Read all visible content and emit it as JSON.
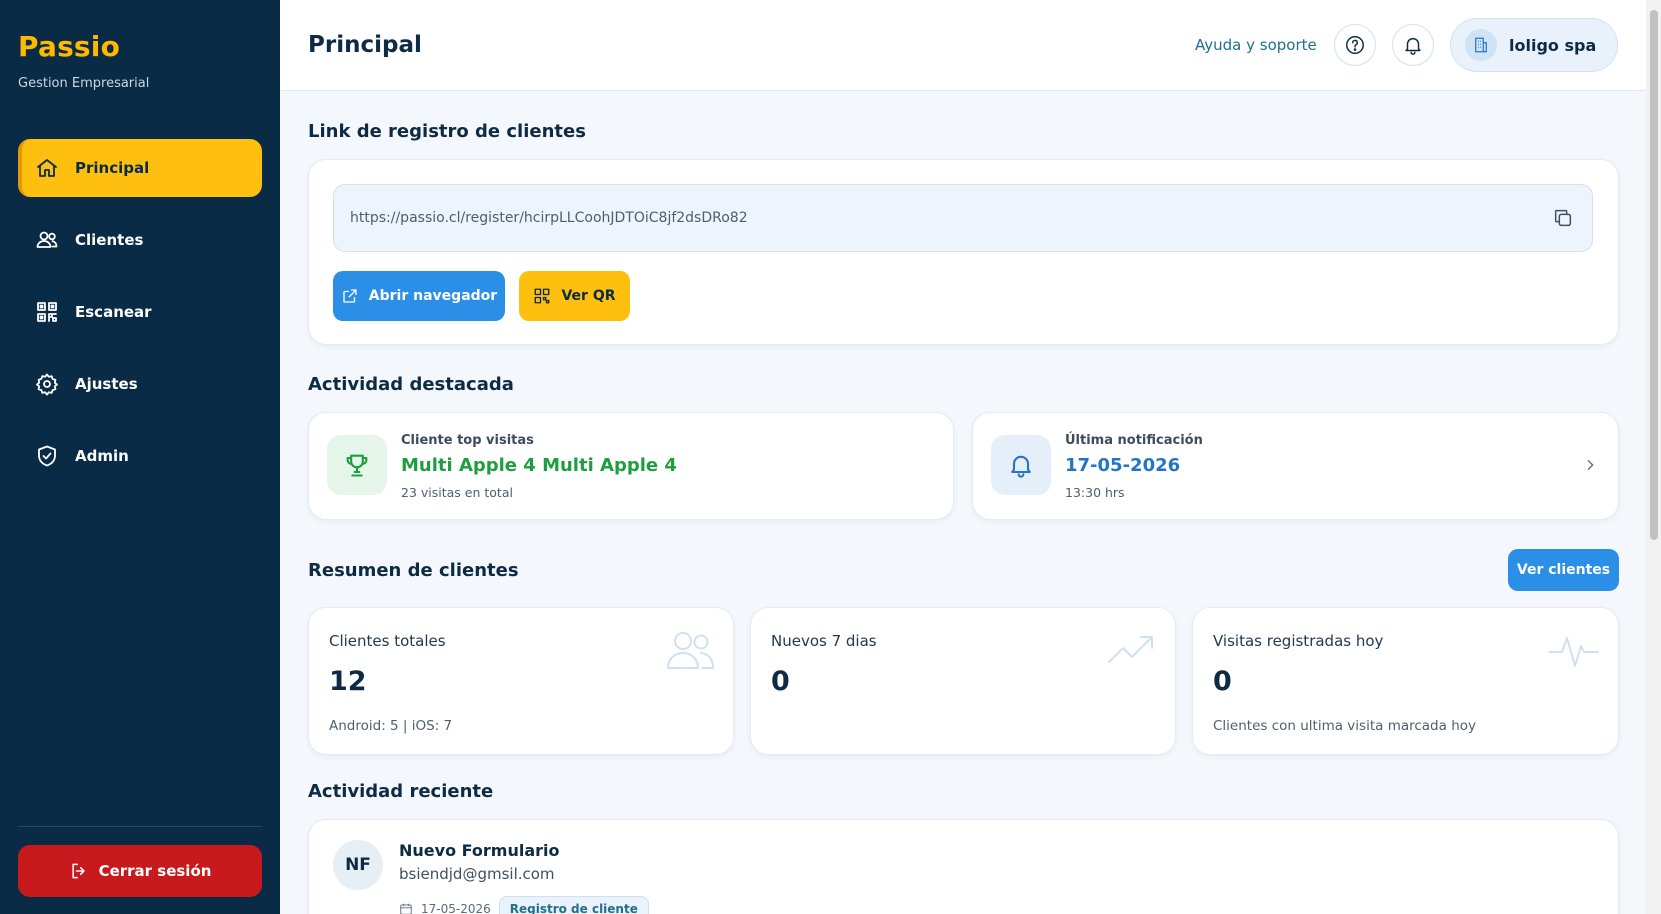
{
  "sidebar": {
    "brand": "Passio",
    "brand_sub": "Gestion Empresarial",
    "items": [
      {
        "label": "Principal",
        "icon": "home-icon"
      },
      {
        "label": "Clientes",
        "icon": "users-icon"
      },
      {
        "label": "Escanear",
        "icon": "qr-scan-icon"
      },
      {
        "label": "Ajustes",
        "icon": "gear-icon"
      },
      {
        "label": "Admin",
        "icon": "shield-icon"
      }
    ],
    "logout_label": "Cerrar sesión"
  },
  "header": {
    "title": "Principal",
    "help_label": "Ayuda y soporte",
    "company_name": "loligo spa"
  },
  "registration": {
    "section_title": "Link de registro de clientes",
    "url": "https://passio.cl/register/hcirpLLCoohJDTOiC8jf2dsDRo82",
    "open_browser_label": "Abrir navegador",
    "view_qr_label": "Ver QR"
  },
  "activity": {
    "section_title": "Actividad destacada",
    "top_client": {
      "label": "Cliente top visitas",
      "value": "Multi Apple 4 Multi Apple 4",
      "sub": "23 visitas en total"
    },
    "last_notification": {
      "label": "Última notificación",
      "value": "17-05-2026",
      "sub": "13:30 hrs"
    }
  },
  "summary": {
    "section_title": "Resumen de clientes",
    "view_clients_label": "Ver clientes",
    "stats": [
      {
        "label": "Clientes totales",
        "value": "12",
        "sub": "Android: 5 | iOS: 7"
      },
      {
        "label": "Nuevos 7 dias",
        "value": "0",
        "sub": ""
      },
      {
        "label": "Visitas registradas hoy",
        "value": "0",
        "sub": "Clientes con ultima visita marcada hoy"
      }
    ]
  },
  "recent": {
    "section_title": "Actividad reciente",
    "items": [
      {
        "initials": "NF",
        "name": "Nuevo Formulario",
        "email": "bsiendjd@gmsil.com",
        "date": "17-05-2026",
        "tag": "Registro de cliente"
      }
    ]
  },
  "colors": {
    "sidebar_bg": "#0a2b46",
    "accent_yellow": "#ffbf0f",
    "primary_blue": "#2b8fe8",
    "danger_red": "#c8191c",
    "success_green": "#1e9e3e",
    "notif_blue": "#2474c4"
  }
}
